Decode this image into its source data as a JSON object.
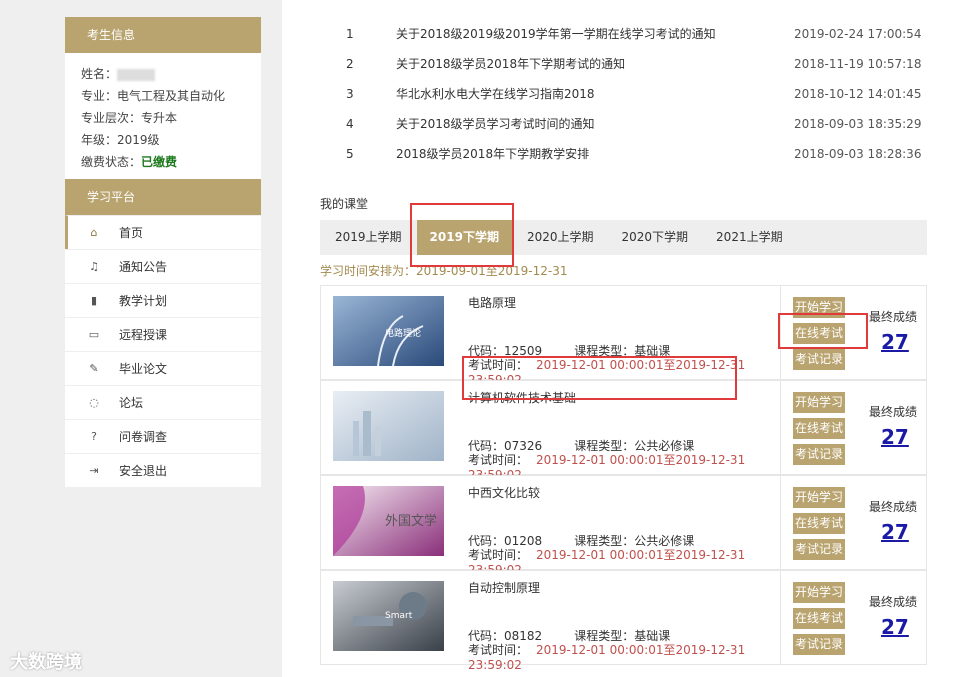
{
  "sidebar": {
    "student_header": "考生信息",
    "info": {
      "name_label": "姓名：",
      "major": "专业：电气工程及其自动化",
      "level": "专业层次：专升本",
      "grade": "年级：2019级",
      "fee_label": "缴费状态：",
      "fee_status": "已缴费"
    },
    "platform_header": "学习平台",
    "nav": [
      {
        "label": "首页",
        "icon": "home-icon"
      },
      {
        "label": "通知公告",
        "icon": "bell-icon"
      },
      {
        "label": "教学计划",
        "icon": "book-icon"
      },
      {
        "label": "远程授课",
        "icon": "monitor-icon"
      },
      {
        "label": "毕业论文",
        "icon": "edit-icon"
      },
      {
        "label": "论坛",
        "icon": "chat-icon"
      },
      {
        "label": "问卷调查",
        "icon": "help-icon"
      },
      {
        "label": "安全退出",
        "icon": "logout-icon"
      }
    ]
  },
  "notices": [
    {
      "no": "1",
      "title": "关于2018级2019级2019学年第一学期在线学习考试的通知",
      "date": "2019-02-24 17:00:54"
    },
    {
      "no": "2",
      "title": "关于2018级学员2018年下学期考试的通知",
      "date": "2018-11-19 10:57:18"
    },
    {
      "no": "3",
      "title": "华北水利水电大学在线学习指南2018",
      "date": "2018-10-12 14:01:45"
    },
    {
      "no": "4",
      "title": "关于2018级学员学习考试时间的通知",
      "date": "2018-09-03 18:35:29"
    },
    {
      "no": "5",
      "title": "2018级学员2018年下学期教学安排",
      "date": "2018-09-03 18:28:36"
    }
  ],
  "my_courses_title": "我的课堂",
  "semester_tabs": [
    "2019上学期",
    "2019下学期",
    "2020上学期",
    "2020下学期",
    "2021上学期"
  ],
  "active_tab": "2019下学期",
  "schedule": "学习时间安排为：2019-09-01至2019-12-31",
  "course_labels": {
    "code_prefix": "代码：",
    "type_prefix": "课程类型：",
    "exam_prefix": "考试时间：",
    "btn_start": "开始学习",
    "btn_exam": "在线考试",
    "btn_record": "考试记录",
    "final_score": "最终成绩"
  },
  "courses": [
    {
      "name": "电路原理",
      "code": "12509",
      "type": "基础课",
      "exam_time": "2019-12-01 00:00:01至2019-12-31 23:59:02",
      "score": "27",
      "thumb_text": "电路理论"
    },
    {
      "name": "计算机软件技术基础",
      "code": "07326",
      "type": "公共必修课",
      "exam_time": "2019-12-01 00:00:01至2019-12-31 23:59:02",
      "score": "27",
      "thumb_text": ""
    },
    {
      "name": "中西文化比较",
      "code": "01208",
      "type": "公共必修课",
      "exam_time": "2019-12-01 00:00:01至2019-12-31 23:59:02",
      "score": "27",
      "thumb_text": "外国文学"
    },
    {
      "name": "自动控制原理",
      "code": "08182",
      "type": "基础课",
      "exam_time": "2019-12-01 00:00:01至2019-12-31 23:59:02",
      "score": "27",
      "thumb_text": "Smart"
    }
  ],
  "watermark": "大数跨境",
  "colors": {
    "accent": "#b9a36f",
    "highlight": "#e03a3a",
    "exam_time": "#c0504d",
    "score": "#1a1aa6",
    "paid": "#1d7a1d"
  }
}
